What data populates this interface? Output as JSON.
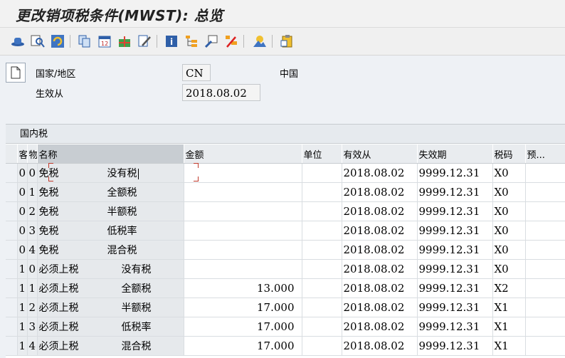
{
  "window": {
    "title": "更改销项税条件(MWST): 总览"
  },
  "toolbar": {
    "icons": [
      "hat-icon",
      "find-icon",
      "refresh-icon",
      "copy-icon",
      "calendar-icon",
      "gift-icon",
      "edit-icon",
      "info-icon",
      "tree-icon",
      "export-icon",
      "delete-icon",
      "landscape-icon",
      "clipboard-icon"
    ]
  },
  "filters": {
    "country_label": "国家/地区",
    "country_value": "CN",
    "country_name": "中国",
    "valid_from_label": "生效从",
    "valid_from_value": "2018.08.02"
  },
  "table": {
    "title": "国内税",
    "headers": {
      "col1": "客",
      "col2": "物",
      "name": "名称",
      "amount": "金额",
      "unit": "单位",
      "valid_from": "有效从",
      "valid_to": "失效期",
      "tax_code": "税码",
      "extra": "预..."
    },
    "rows": [
      {
        "k1": "0",
        "k2": "0",
        "name1": "免税",
        "name2": "没有税",
        "amount": "",
        "unit": "",
        "from": "2018.08.02",
        "to": "9999.12.31",
        "tax": "X0"
      },
      {
        "k1": "0",
        "k2": "1",
        "name1": "免税",
        "name2": "全额税",
        "amount": "",
        "unit": "",
        "from": "2018.08.02",
        "to": "9999.12.31",
        "tax": "X0"
      },
      {
        "k1": "0",
        "k2": "2",
        "name1": "免税",
        "name2": "半额税",
        "amount": "",
        "unit": "",
        "from": "2018.08.02",
        "to": "9999.12.31",
        "tax": "X0"
      },
      {
        "k1": "0",
        "k2": "3",
        "name1": "免税",
        "name2": "低税率",
        "amount": "",
        "unit": "",
        "from": "2018.08.02",
        "to": "9999.12.31",
        "tax": "X0"
      },
      {
        "k1": "0",
        "k2": "4",
        "name1": "免税",
        "name2": "混合税",
        "amount": "",
        "unit": "",
        "from": "2018.08.02",
        "to": "9999.12.31",
        "tax": "X0"
      },
      {
        "k1": "1",
        "k2": "0",
        "name1": "必须上税",
        "name2": "没有税",
        "amount": "",
        "unit": "",
        "from": "2018.08.02",
        "to": "9999.12.31",
        "tax": "X0"
      },
      {
        "k1": "1",
        "k2": "1",
        "name1": "必须上税",
        "name2": "全额税",
        "amount": "13.000",
        "unit": "",
        "from": "2018.08.02",
        "to": "9999.12.31",
        "tax": "X2"
      },
      {
        "k1": "1",
        "k2": "2",
        "name1": "必须上税",
        "name2": "半额税",
        "amount": "17.000",
        "unit": "",
        "from": "2018.08.02",
        "to": "9999.12.31",
        "tax": "X1"
      },
      {
        "k1": "1",
        "k2": "3",
        "name1": "必须上税",
        "name2": "低税率",
        "amount": "17.000",
        "unit": "",
        "from": "2018.08.02",
        "to": "9999.12.31",
        "tax": "X1"
      },
      {
        "k1": "1",
        "k2": "4",
        "name1": "必须上税",
        "name2": "混合税",
        "amount": "17.000",
        "unit": "",
        "from": "2018.08.02",
        "to": "9999.12.31",
        "tax": "X1"
      }
    ]
  }
}
